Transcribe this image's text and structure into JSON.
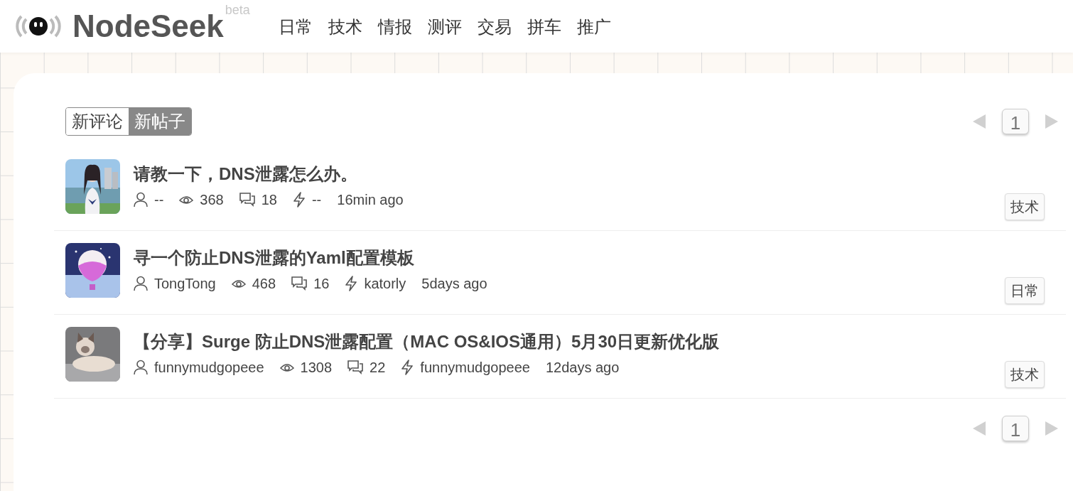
{
  "header": {
    "logo": "NodeSeek",
    "badge": "beta",
    "nav": [
      "日常",
      "技术",
      "情报",
      "测评",
      "交易",
      "拼车",
      "推广"
    ]
  },
  "tabs": [
    {
      "label": "新评论",
      "selected": false
    },
    {
      "label": "新帖子",
      "selected": true
    }
  ],
  "pager_top": {
    "page": "1"
  },
  "posts": [
    {
      "title": "请教一下，DNS泄露怎么办。",
      "author": "--",
      "views": "368",
      "comments": "18",
      "last_reply": "--",
      "time": "16min ago",
      "tag": "技术"
    },
    {
      "title": "寻一个防止DNS泄露的Yaml配置模板",
      "author": "TongTong",
      "views": "468",
      "comments": "16",
      "last_reply": "katorly",
      "time": "5days ago",
      "tag": "日常"
    },
    {
      "title": "【分享】Surge 防止DNS泄露配置（MAC OS&IOS通用）5月30日更新优化版",
      "author": "funnymudgopeee",
      "views": "1308",
      "comments": "22",
      "last_reply": "funnymudgopeee",
      "time": "12days ago",
      "tag": "技术"
    }
  ],
  "pager_bottom": {
    "page": "1"
  }
}
